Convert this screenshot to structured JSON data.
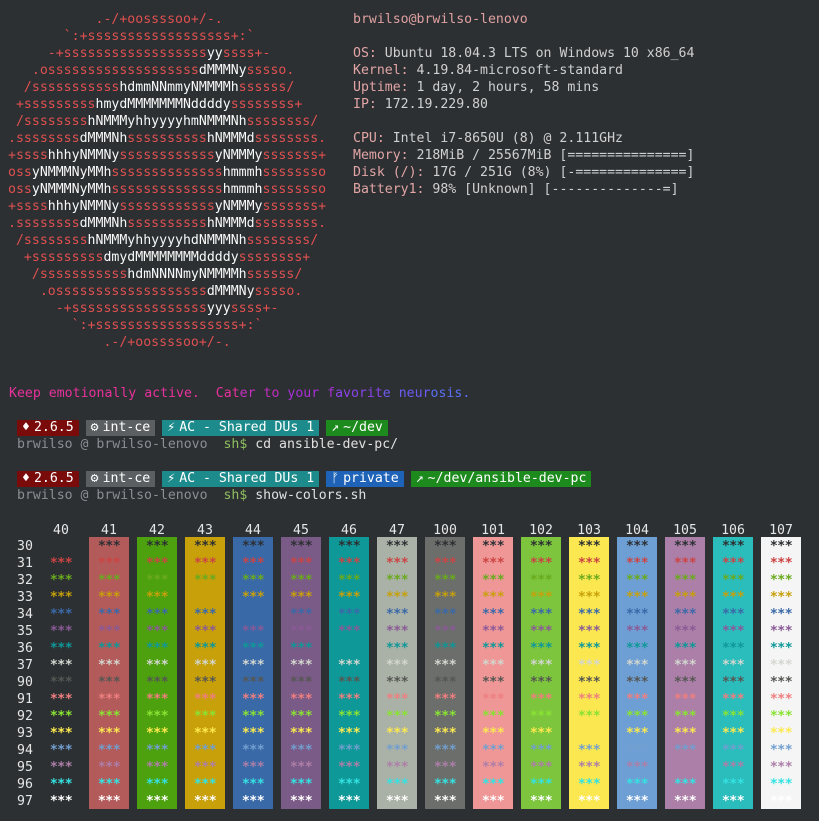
{
  "logo": {
    "lines": [
      "           .-/+oossssoo+/-.",
      "       `:+ssssssssssssssssss+:`",
      "     -+ssssssssssssssssssyyssss+-",
      "   .osssssssssssssssssssdMMMNysssso.",
      "  /ssssssssssshdmmNNmmyNMMMMhssssss/",
      " +ssssssssshmydMMMMMMMNddddyssssssss+",
      " /sssssssshNMMMyhhyyyyhmNMMMNhssssssss/",
      ".ssssssssdMMMNhsssssssssshNMMMdssssssss.",
      "+sssshhhyNMMNyssssssssssssyNMMMysssssss+",
      "ossyNMMMNyMMhsssssssssssssshmmmhssssssso",
      "ossyNMMMNyMMhsssssssssssssshmmmhssssssso",
      "+sssshhhyNMMNyssssssssssssyNMMMysssssss+",
      ".ssssssssdMMMNhsssssssssshNMMMdssssssss.",
      " /sssssssshNMMMyhhyyyyhdNMMMNhssssssss/",
      "  +sssssssssdmydMMMMMMMMddddyssssssss+",
      "   /ssssssssssshdmNNNNmyNMMMMhssssss/",
      "    .osssssssssssssssssssdMMMNysssso.",
      "      -+sssssssssssssssssyyyssss+-",
      "        `:+ssssssssssssssssss+:`",
      "            .-/+oossssoo+/-."
    ]
  },
  "info": {
    "header": "brwilso@brwilso-lenovo",
    "rows": [
      {
        "key": "OS",
        "value": "Ubuntu 18.04.3 LTS on Windows 10 x86_64"
      },
      {
        "key": "Kernel",
        "value": "4.19.84-microsoft-standard"
      },
      {
        "key": "Uptime",
        "value": "1 day, 2 hours, 58 mins"
      },
      {
        "key": "IP",
        "value": "172.19.229.80"
      },
      {
        "key": "",
        "value": ""
      },
      {
        "key": "CPU",
        "value": "Intel i7-8650U (8) @ 2.111GHz"
      },
      {
        "key": "Memory",
        "value": "218MiB / 25567MiB [===============]"
      },
      {
        "key": "Disk (/)",
        "value": "17G / 251G (8%) [-==============]"
      },
      {
        "key": "Battery1",
        "value": "98% [Unknown] [--------------=]"
      }
    ]
  },
  "quote": {
    "text": "Keep emotionally active.  Cater to your favorite neurosis.",
    "colors": [
      "#e8319c",
      "#e8319c",
      "#e8319c",
      "#e8319c",
      "#e8319c",
      "#c22fbe",
      "#a92fd6",
      "#8c43e8",
      "#6c5cf0",
      "#5a6ff4"
    ]
  },
  "prompts": [
    {
      "segments": [
        {
          "icon": "♦",
          "label": "2.6.5",
          "bg": "#7a0b0b"
        },
        {
          "icon": "⚙",
          "label": "int-ce",
          "bg": "#5b5f62"
        },
        {
          "icon": "⚡",
          "label": "AC - Shared DUs 1",
          "bg": "#1d8b8b"
        },
        {
          "icon": "↗",
          "label": "~/dev",
          "bg": "#1c8a1c"
        }
      ],
      "user": "brwilso",
      "at": "@",
      "host": "brwilso-lenovo",
      "shell": "sh$",
      "command": "cd ansible-dev-pc/"
    },
    {
      "segments": [
        {
          "icon": "♦",
          "label": "2.6.5",
          "bg": "#7a0b0b"
        },
        {
          "icon": "⚙",
          "label": "int-ce",
          "bg": "#5b5f62"
        },
        {
          "icon": "⚡",
          "label": "AC - Shared DUs 1",
          "bg": "#1d8b8b"
        },
        {
          "icon": "ᚠ",
          "label": "private",
          "bg": "#1e63b8"
        },
        {
          "icon": "↗",
          "label": "~/dev/ansible-dev-pc",
          "bg": "#1c8a1c"
        }
      ],
      "user": "brwilso",
      "at": "@",
      "host": "brwilso-lenovo",
      "shell": "sh$",
      "command": "show-colors.sh"
    }
  ],
  "colors_table": {
    "cell_text": "***",
    "bg_codes": [
      "40",
      "41",
      "42",
      "43",
      "44",
      "45",
      "46",
      "47",
      "100",
      "101",
      "102",
      "103",
      "104",
      "105",
      "106",
      "107"
    ],
    "bg_colors": [
      "",
      "#b35a5a",
      "#4ea10e",
      "#c8a00a",
      "#3a69a8",
      "#7a5a86",
      "#0f9898",
      "#aab1a7",
      "#6b6e6b",
      "#ef9797",
      "#7cc53d",
      "#fbe74f",
      "#6e9fd4",
      "#ab7fa8",
      "#2bbcbc",
      "#f5f5f5"
    ],
    "fg_codes": [
      "30",
      "31",
      "32",
      "33",
      "34",
      "35",
      "36",
      "37",
      "90",
      "91",
      "92",
      "93",
      "94",
      "95",
      "96",
      "97"
    ],
    "fg_colors": [
      "#2c3033",
      "#cc4444",
      "#6aaa1e",
      "#c8a00a",
      "#3a69a8",
      "#8a5a96",
      "#0f9898",
      "#d3d7cf",
      "#555753",
      "#ef7f7f",
      "#8ae234",
      "#fce94f",
      "#729fcf",
      "#ad7fa8",
      "#34e2e2",
      "#ffffff"
    ]
  }
}
